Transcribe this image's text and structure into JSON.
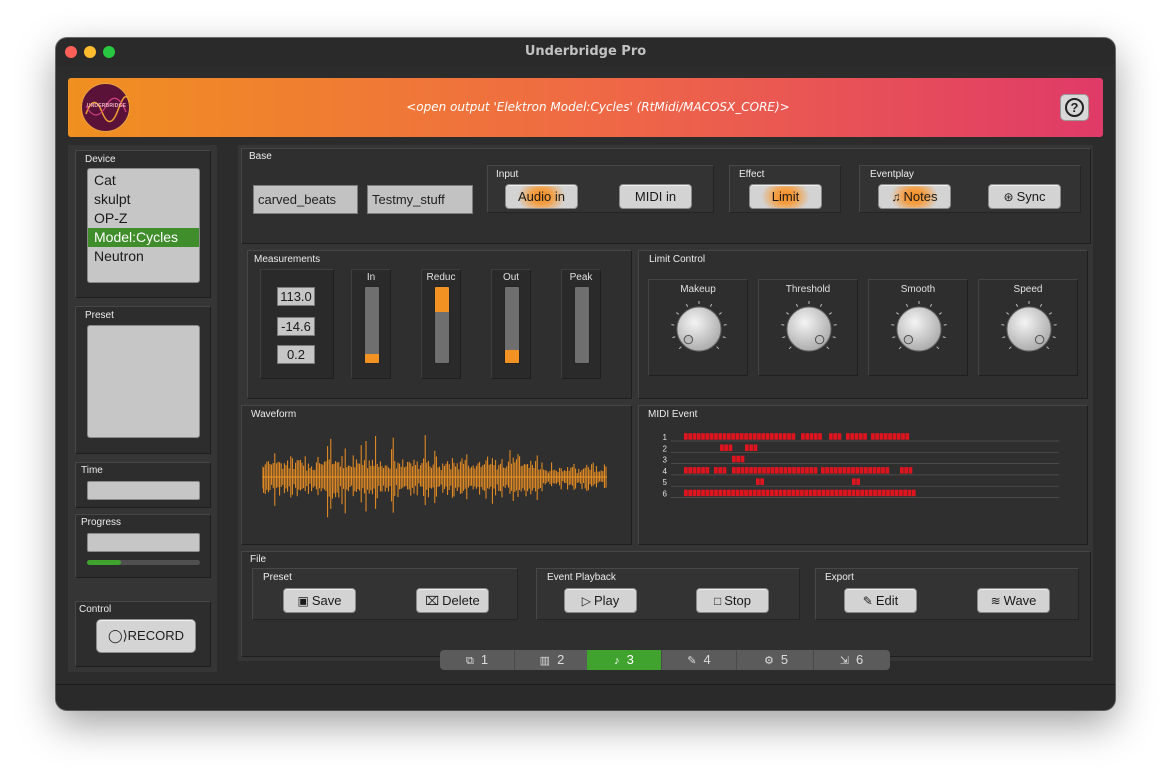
{
  "window": {
    "title": "Underbridge Pro"
  },
  "banner": {
    "logo_text": "UNDERBRIDGE",
    "status": "<open output 'Elektron Model:Cycles' (RtMidi/MACOSX_CORE)>",
    "help_icon": "question-circle-icon",
    "help_label": "?",
    "colors": {
      "start": "#f09020",
      "end": "#e03a68"
    }
  },
  "sidebar": {
    "device": {
      "label": "Device",
      "items": [
        "Cat",
        "skulpt",
        "OP-Z",
        "Model:Cycles",
        "Neutron"
      ],
      "selected": "Model:Cycles"
    },
    "preset": {
      "label": "Preset"
    },
    "time": {
      "label": "Time",
      "value": ""
    },
    "progress": {
      "label": "Progress",
      "value": "",
      "level": 0.3
    },
    "control": {
      "label": "Control",
      "record_label": "RECORD",
      "record_icon": "record-icon"
    }
  },
  "base": {
    "label": "Base",
    "field1": "carved_beats",
    "field2": "Testmy_stuff",
    "input": {
      "label": "Input",
      "audio_in": "Audio in",
      "midi_in": "MIDI in"
    },
    "effect": {
      "label": "Effect",
      "limit": "Limit"
    },
    "eventplay": {
      "label": "Eventplay",
      "notes": "Notes",
      "sync": "Sync"
    }
  },
  "measurements": {
    "label": "Measurements",
    "values": [
      "113.0",
      "-14.6",
      "0.2"
    ],
    "meters": [
      {
        "label": "In",
        "level": 0.12,
        "from": "bottom"
      },
      {
        "label": "Reduc",
        "level": 0.33,
        "from": "top"
      },
      {
        "label": "Out",
        "level": 0.17,
        "from": "bottom"
      },
      {
        "label": "Peak",
        "level": 0.0,
        "from": "bottom"
      }
    ]
  },
  "limit_control": {
    "label": "Limit Control",
    "knobs": [
      {
        "label": "Makeup",
        "value": 0.0
      },
      {
        "label": "Threshold",
        "value": 1.0
      },
      {
        "label": "Smooth",
        "value": 0.0
      },
      {
        "label": "Speed",
        "value": 1.0
      }
    ]
  },
  "waveform": {
    "label": "Waveform",
    "color": "#f19222"
  },
  "midi_event": {
    "label": "MIDI Event",
    "rows": [
      "1",
      "2",
      "3",
      "4",
      "5",
      "6"
    ],
    "color": "#e0141e"
  },
  "file": {
    "label": "File",
    "preset": {
      "label": "Preset",
      "save": "Save",
      "delete": "Delete"
    },
    "event_playback": {
      "label": "Event Playback",
      "play": "Play",
      "stop": "Stop"
    },
    "export": {
      "label": "Export",
      "edit": "Edit",
      "wave": "Wave"
    }
  },
  "tabs": [
    {
      "label": "1",
      "icon": "gallery-icon"
    },
    {
      "label": "2",
      "icon": "piano-icon"
    },
    {
      "label": "3",
      "icon": "music-note-icon"
    },
    {
      "label": "4",
      "icon": "pencil-icon"
    },
    {
      "label": "5",
      "icon": "gear-icon"
    },
    {
      "label": "6",
      "icon": "export-icon"
    }
  ],
  "active_tab": "3"
}
